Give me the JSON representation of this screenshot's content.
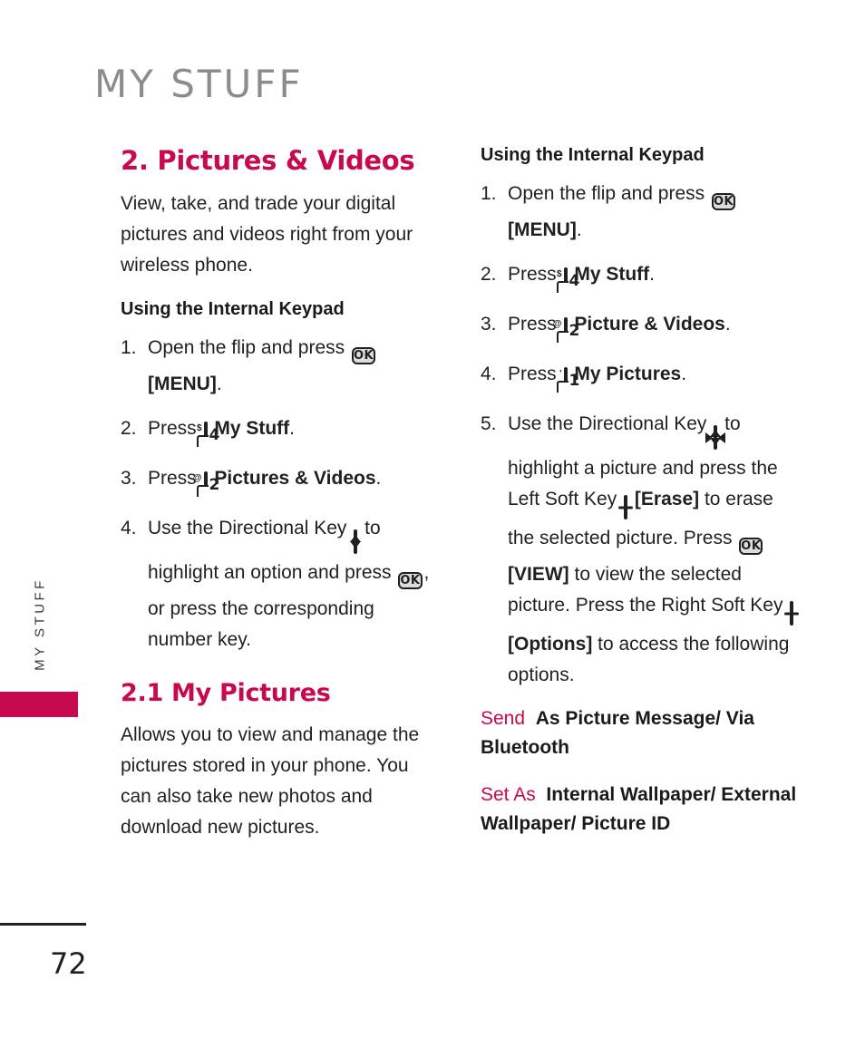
{
  "page": {
    "chapter_header": "MY STUFF",
    "side_tab_label": "MY STUFF",
    "page_number": "72",
    "accent_color": "#c8094f",
    "header_color": "#8c8c8c",
    "text_color": "#231f20",
    "key_fill_color": "#dcdcdc"
  },
  "left_column": {
    "section_heading": "2. Pictures & Videos",
    "intro_paragraph": "View, take, and trade your digital pictures and videos right from your wireless phone.",
    "subheading": "Using the Internal Keypad",
    "steps": [
      {
        "num": "1.",
        "parts": [
          {
            "type": "text",
            "value": "Open the flip and press "
          },
          {
            "type": "key",
            "icon": "ok-key",
            "label": "OK"
          },
          {
            "type": "bold",
            "value": " [MENU]"
          },
          {
            "type": "text",
            "value": "."
          }
        ]
      },
      {
        "num": "2.",
        "parts": [
          {
            "type": "text",
            "value": "Press "
          },
          {
            "type": "key",
            "icon": "number-key-4",
            "digit": "4",
            "sup": "$"
          },
          {
            "type": "bold",
            "value": " My Stuff"
          },
          {
            "type": "text",
            "value": "."
          }
        ]
      },
      {
        "num": "3.",
        "parts": [
          {
            "type": "text",
            "value": "Press "
          },
          {
            "type": "key",
            "icon": "number-key-2",
            "digit": "2",
            "sup": "@"
          },
          {
            "type": "bold",
            "value": " Pictures & Videos"
          },
          {
            "type": "text",
            "value": "."
          }
        ]
      },
      {
        "num": "4.",
        "parts": [
          {
            "type": "text",
            "value": "Use the Directional Key "
          },
          {
            "type": "key",
            "icon": "directional-key-vertical"
          },
          {
            "type": "text",
            "value": " to highlight an option and press "
          },
          {
            "type": "key",
            "icon": "ok-key",
            "label": "OK"
          },
          {
            "type": "text",
            "value": ", or press the corresponding number key."
          }
        ]
      }
    ],
    "subsection_heading": "2.1 My Pictures",
    "subsection_paragraph": "Allows you to view and manage the pictures stored in your phone. You can also take new photos and download new pictures."
  },
  "right_column": {
    "subheading": "Using the Internal Keypad",
    "steps": [
      {
        "num": "1.",
        "parts": [
          {
            "type": "text",
            "value": "Open the flip and press "
          },
          {
            "type": "key",
            "icon": "ok-key",
            "label": "OK"
          },
          {
            "type": "bold",
            "value": " [MENU]"
          },
          {
            "type": "text",
            "value": "."
          }
        ]
      },
      {
        "num": "2.",
        "parts": [
          {
            "type": "text",
            "value": "Press "
          },
          {
            "type": "key",
            "icon": "number-key-4",
            "digit": "4",
            "sup": "$"
          },
          {
            "type": "bold",
            "value": " My Stuff"
          },
          {
            "type": "text",
            "value": "."
          }
        ]
      },
      {
        "num": "3.",
        "parts": [
          {
            "type": "text",
            "value": "Press "
          },
          {
            "type": "key",
            "icon": "number-key-2",
            "digit": "2",
            "sup": "@"
          },
          {
            "type": "bold",
            "value": " Picture & Videos"
          },
          {
            "type": "text",
            "value": "."
          }
        ]
      },
      {
        "num": "4.",
        "parts": [
          {
            "type": "text",
            "value": "Press "
          },
          {
            "type": "key",
            "icon": "number-key-1",
            "digit": "1",
            "sup": "'"
          },
          {
            "type": "bold",
            "value": " My Pictures"
          },
          {
            "type": "text",
            "value": "."
          }
        ]
      },
      {
        "num": "5.",
        "parts": [
          {
            "type": "text",
            "value": "Use the Directional Key "
          },
          {
            "type": "key",
            "icon": "directional-key-four-way"
          },
          {
            "type": "text",
            "value": " to highlight a picture and press the Left Soft Key "
          },
          {
            "type": "key",
            "icon": "left-soft-key"
          },
          {
            "type": "bold",
            "value": " [Erase]"
          },
          {
            "type": "text",
            "value": " to erase the selected picture. Press "
          },
          {
            "type": "key",
            "icon": "ok-key",
            "label": "OK"
          },
          {
            "type": "bold",
            "value": " [VIEW]"
          },
          {
            "type": "text",
            "value": " to view the selected picture. Press the Right Soft Key "
          },
          {
            "type": "key",
            "icon": "right-soft-key"
          },
          {
            "type": "bold",
            "value": " [Options]"
          },
          {
            "type": "text",
            "value": " to access the following options."
          }
        ]
      }
    ],
    "options": [
      {
        "label": "Send",
        "values": "As Picture Message/ Via Bluetooth"
      },
      {
        "label": "Set As",
        "values": "Internal Wallpaper/ External Wallpaper/ Picture ID"
      }
    ]
  }
}
